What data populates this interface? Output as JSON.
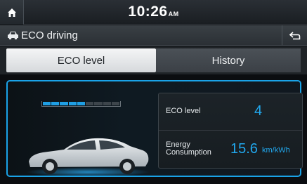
{
  "status": {
    "time": "10:26",
    "ampm": "AM"
  },
  "header": {
    "title": "ECO driving"
  },
  "tabs": [
    {
      "label": "ECO level",
      "active": true
    },
    {
      "label": "History",
      "active": false
    }
  ],
  "eco_gauge": {
    "filled": 5,
    "total": 9
  },
  "info": {
    "eco_level_label": "ECO level",
    "eco_level_value": "4",
    "energy_label_line1": "Energy",
    "energy_label_line2": "Consumption",
    "energy_value": "15.6",
    "energy_unit": "km/kWh"
  },
  "colors": {
    "accent": "#1aa3e8",
    "value": "#21a8ee"
  },
  "icons": {
    "home": "home-icon",
    "car": "car-icon",
    "back": "back-icon"
  }
}
